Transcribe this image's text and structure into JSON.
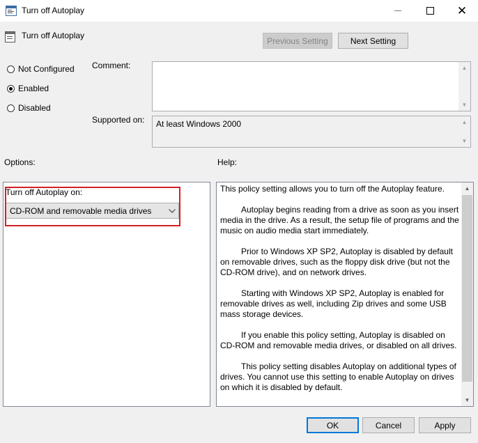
{
  "window": {
    "title": "Turn off Autoplay"
  },
  "header": {
    "policy_name": "Turn off Autoplay",
    "previous_label": "Previous Setting",
    "next_label": "Next Setting"
  },
  "state": {
    "options": [
      {
        "label": "Not Configured",
        "selected": false
      },
      {
        "label": "Enabled",
        "selected": true
      },
      {
        "label": "Disabled",
        "selected": false
      }
    ]
  },
  "fields": {
    "comment_label": "Comment:",
    "comment_value": "",
    "supported_label": "Supported on:",
    "supported_value": "At least Windows 2000"
  },
  "options_section": {
    "label": "Options:",
    "combo_label": "Turn off Autoplay on:",
    "combo_value": "CD-ROM and removable media drives"
  },
  "help_section": {
    "label": "Help:",
    "paragraphs": [
      "This policy setting allows you to turn off the Autoplay feature.",
      "Autoplay begins reading from a drive as soon as you insert media in the drive. As a result, the setup file of programs and the music on audio media start immediately.",
      "Prior to Windows XP SP2, Autoplay is disabled by default on removable drives, such as the floppy disk drive (but not the CD-ROM drive), and on network drives.",
      "Starting with Windows XP SP2, Autoplay is enabled for removable drives as well, including Zip drives and some USB mass storage devices.",
      "If you enable this policy setting, Autoplay is disabled on CD-ROM and removable media drives, or disabled on all drives.",
      "This policy setting disables Autoplay on additional types of drives. You cannot use this setting to enable Autoplay on drives on which it is disabled by default."
    ]
  },
  "footer": {
    "ok_label": "OK",
    "cancel_label": "Cancel",
    "apply_label": "Apply"
  },
  "icons": {
    "app": "policy-window-icon",
    "policy": "policy-setting-icon",
    "combo_arrow": "chevron-down-icon"
  },
  "colors": {
    "highlight_box": "#d32027",
    "default_button_border": "#0078d7"
  }
}
